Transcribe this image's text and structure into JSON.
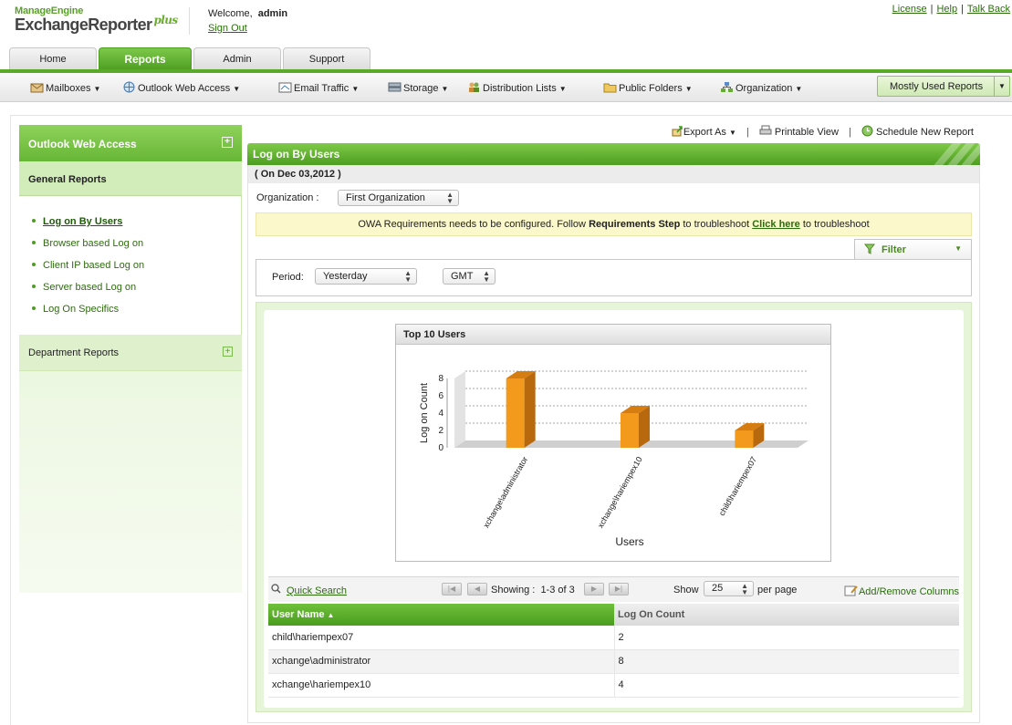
{
  "brand": {
    "top": "ManageEngine",
    "name": "ExchangeReporter",
    "suffix": "plus"
  },
  "user": {
    "welcome": "Welcome,",
    "name": "admin",
    "signout": "Sign Out"
  },
  "toplinks": [
    "License",
    "Help",
    "Talk Back"
  ],
  "tabs": [
    {
      "label": "Home",
      "active": false
    },
    {
      "label": "Reports",
      "active": true
    },
    {
      "label": "Admin",
      "active": false
    },
    {
      "label": "Support",
      "active": false
    }
  ],
  "submenu": [
    {
      "label": "Mailboxes",
      "icon": "mailbox-icon"
    },
    {
      "label": "Outlook Web Access",
      "icon": "owa-icon"
    },
    {
      "label": "Email Traffic",
      "icon": "email-traffic-icon"
    },
    {
      "label": "Storage",
      "icon": "storage-icon"
    },
    {
      "label": "Distribution Lists",
      "icon": "users-icon"
    },
    {
      "label": "Public Folders",
      "icon": "folder-icon"
    },
    {
      "label": "Organization",
      "icon": "organization-icon"
    }
  ],
  "mostused": "Mostly Used Reports",
  "left": {
    "title": "Outlook Web Access",
    "section": "General Reports",
    "items": [
      "Log on By Users",
      "Browser based Log on",
      "Client IP based Log on",
      "Server based Log on",
      "Log On Specifics"
    ],
    "active_index": 0,
    "department": "Department Reports"
  },
  "actions": {
    "export": "Export As",
    "print": "Printable View",
    "schedule": "Schedule New Report"
  },
  "report": {
    "title": "Log on By Users",
    "date": "( On Dec 03,2012 )",
    "org_label": "Organization :",
    "org_value": "First Organization",
    "notice_pre": "OWA Requirements needs to be configured. Follow",
    "notice_bold": "Requirements Step",
    "notice_mid": "to troubleshoot",
    "notice_link": "Click here",
    "notice_post": "to troubleshoot",
    "filter": "Filter",
    "period_label": "Period:",
    "period_value": "Yesterday",
    "tz_value": "GMT"
  },
  "chart_data": {
    "type": "bar",
    "title": "Top 10 Users",
    "xlabel": "Users",
    "ylabel": "Log on Count",
    "categories": [
      "xchange\\administrator",
      "xchange\\hariempex10",
      "child\\hariempex07"
    ],
    "values": [
      8,
      4,
      2
    ],
    "ylim": [
      0,
      8
    ],
    "yticks": [
      0,
      2,
      4,
      6,
      8
    ],
    "color": "#f39a1c",
    "grid": true
  },
  "table": {
    "quick_search": "Quick Search",
    "showing_label": "Showing :",
    "showing_value": "1-3 of 3",
    "show_label": "Show",
    "per_page_value": "25",
    "per_page_label": "per page",
    "add_remove": "Add/Remove Columns",
    "columns": [
      "User Name",
      "Log On Count"
    ],
    "rows": [
      [
        "child\\hariempex07",
        "2"
      ],
      [
        "xchange\\administrator",
        "8"
      ],
      [
        "xchange\\hariempex10",
        "4"
      ]
    ]
  }
}
